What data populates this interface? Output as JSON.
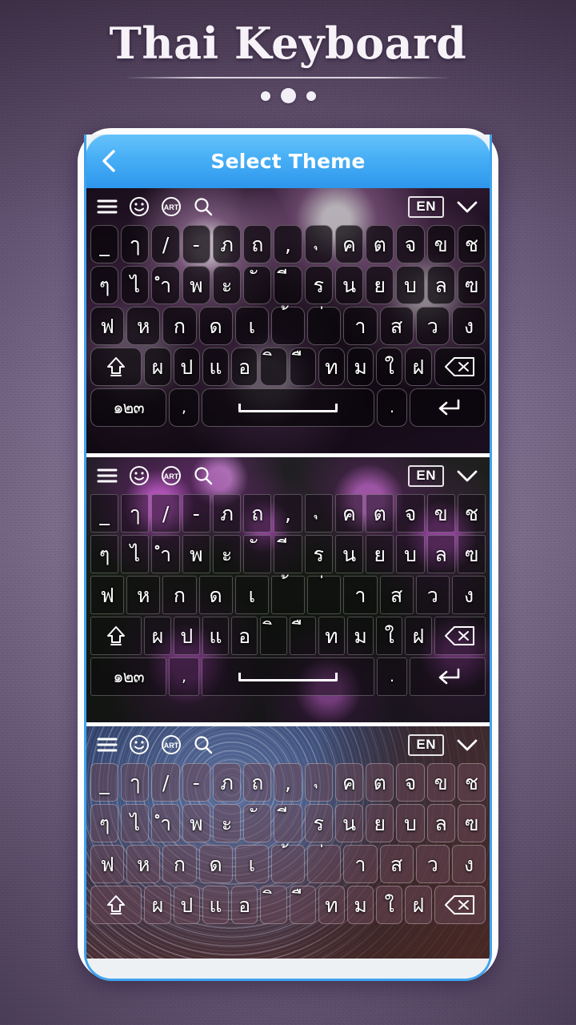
{
  "page": {
    "title": "Thai Keyboard",
    "dots": [
      "small",
      "large",
      "small"
    ],
    "background_color": "#6f5f80"
  },
  "appbar": {
    "title": "Select Theme",
    "back_icon": "chevron-left-icon",
    "accent_color": "#49b0f6"
  },
  "toolbar": {
    "menu_icon": "hamburger-menu-icon",
    "emoji_icon": "smiley-face-icon",
    "art_icon": "art-circle-icon",
    "art_label": "ART",
    "search_icon": "search-icon",
    "language_label": "EN",
    "collapse_icon": "chevron-down-icon"
  },
  "keyboard_layout": {
    "row1": [
      "_",
      "ๅ",
      "/",
      "-",
      "ภ",
      "ถ",
      ",",
      "ุ",
      "ค",
      "ต",
      "จ",
      "ข",
      "ช"
    ],
    "row2": [
      "ๆ",
      "ไ",
      "ำ",
      "พ",
      "ะ",
      "ั",
      "ี",
      "ร",
      "น",
      "ย",
      "บ",
      "ล",
      "ฃ"
    ],
    "row3": [
      "ฟ",
      "ห",
      "ก",
      "ด",
      "เ",
      "้",
      "่",
      "า",
      "ส",
      "ว",
      "ง"
    ],
    "row4_shift": "shift-up-icon",
    "row4": [
      "ผ",
      "ป",
      "แ",
      "อ",
      "ิ",
      "ื",
      "ท",
      "ม",
      "ใ",
      "ฝ"
    ],
    "row4_backspace": "backspace-delete-icon",
    "row5_numbers": "๑๒๓",
    "row5_comma": ",",
    "row5_space": "spacebar",
    "row5_period": ".",
    "row5_enter": "enter-return-icon"
  },
  "themes": [
    {
      "name": "purple-smoke-theme",
      "key_style": "rounded-dark"
    },
    {
      "name": "lavender-flowers-theme",
      "key_style": "square-translucent"
    },
    {
      "name": "blue-star-trails-theme",
      "key_style": "mauve-rounded"
    }
  ]
}
